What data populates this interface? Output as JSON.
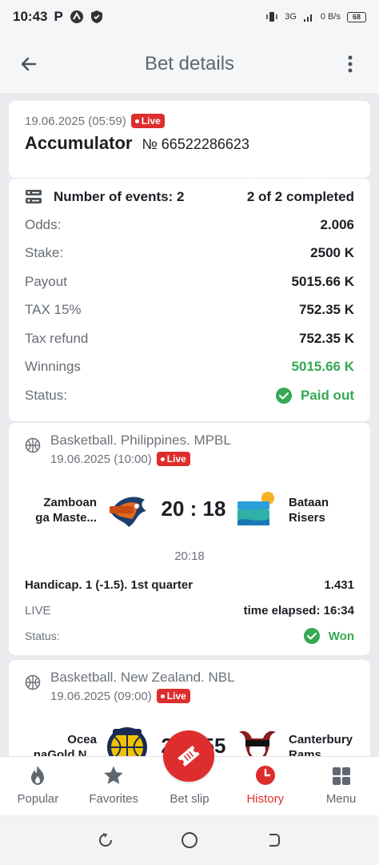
{
  "status_bar": {
    "time": "10:43",
    "network_text": "3G",
    "speed_text": "0 B/s",
    "battery": "68"
  },
  "app_bar": {
    "title": "Bet details"
  },
  "summary": {
    "date": "19.06.2025 (05:59)",
    "live_label": "Live",
    "type": "Accumulator",
    "number": "№ 66522286623"
  },
  "details": {
    "events_label": "Number of events: 2",
    "completed": "2 of 2 completed",
    "rows": [
      {
        "label": "Odds:",
        "value": "2.006"
      },
      {
        "label": "Stake:",
        "value": "2500 K"
      },
      {
        "label": "Payout",
        "value": "5015.66 K"
      },
      {
        "label": "TAX 15%",
        "value": "752.35 K"
      },
      {
        "label": "Tax refund",
        "value": "752.35 K"
      },
      {
        "label": "Winnings",
        "value": "5015.66 K"
      }
    ],
    "status_label": "Status:",
    "status_value": "Paid out"
  },
  "events": [
    {
      "league": "Basketball. Philippines. MPBL",
      "date": "19.06.2025 (10:00)",
      "live_label": "Live",
      "team_home": "Zamboan ga Maste...",
      "team_away": "Bataan Risers",
      "score": "20 : 18",
      "subscore": "20:18",
      "bet": "Handicap. 1 (-1.5). 1st quarter",
      "odds": "1.431",
      "live_text": "LIVE",
      "elapsed": "time elapsed: 16:34",
      "status_label": "Status:",
      "status_value": "Won"
    },
    {
      "league": "Basketball. New Zealand. NBL",
      "date": "19.06.2025 (09:00)",
      "live_label": "Live",
      "team_home": "Ocea naGold N...",
      "team_away": "Canterbury Rams",
      "score": "20 : 55"
    }
  ],
  "bottom_nav": {
    "items": [
      {
        "label": "Popular",
        "icon": "flame-icon"
      },
      {
        "label": "Favorites",
        "icon": "star-icon"
      },
      {
        "label": "Bet slip",
        "icon": "ticket-icon"
      },
      {
        "label": "History",
        "icon": "clock-icon"
      },
      {
        "label": "Menu",
        "icon": "grid-icon"
      }
    ]
  },
  "colors": {
    "accent": "#de2d2d",
    "success": "#35a853",
    "muted": "#6c737b"
  }
}
